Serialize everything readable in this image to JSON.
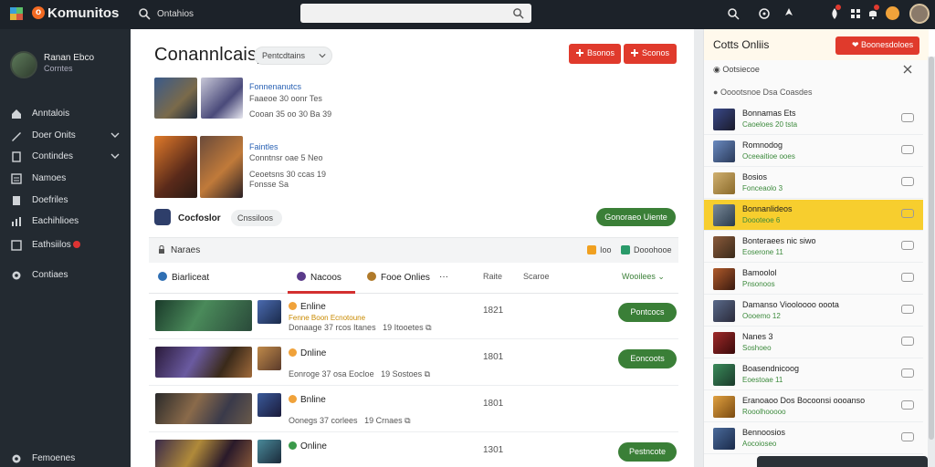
{
  "topbar": {
    "brand": "Komunitos",
    "nav_label": "Ontahios",
    "search_placeholder": "",
    "icons": [
      "search-icon",
      "compass-icon",
      "rocket-icon",
      "fire-icon",
      "grid-icon",
      "bell-icon"
    ]
  },
  "sidebar": {
    "user_name": "Ranan Ebco",
    "user_sub": "Corntes",
    "items": [
      {
        "label": "Anntalois",
        "icon": "home-icon",
        "chevron": false
      },
      {
        "label": "Doer Onits",
        "icon": "tag-icon",
        "chevron": true
      },
      {
        "label": "Contindes",
        "icon": "book-icon",
        "chevron": true
      },
      {
        "label": "Namoes",
        "icon": "list-icon",
        "chevron": false
      },
      {
        "label": "Doefriles",
        "icon": "doc-icon",
        "chevron": false
      },
      {
        "label": "Eachihlioes",
        "icon": "chart-icon",
        "chevron": false
      },
      {
        "label": "Eathsiilos",
        "icon": "flag-icon",
        "chevron": false
      },
      {
        "label": "Contiaes",
        "icon": "settings-icon",
        "chevron": false
      },
      {
        "label": "Femoenes",
        "icon": "gear-icon",
        "chevron": false
      }
    ]
  },
  "main": {
    "title": "Conannlcaisy",
    "dropdown": "Pentcdtains",
    "btn1": "Bsonos",
    "btn2": "Sconos",
    "featured": [
      {
        "title": "Fonnenanutcs",
        "sub1": "Faaeoe 30 oonr Tes",
        "sub2": "Cooan 35 oo 30 Ba 39"
      },
      {
        "title": "Faintles",
        "sub1": "Conntnsr oae 5 Neo",
        "sub2": "Ceoetsns 30 ccas 19",
        "sub3": "Fonsse Sa"
      }
    ],
    "cl_title": "Cocfoslor",
    "cl_pill": "Cnssiloos",
    "cl_btn": "Gonoraeo Uiente",
    "section": {
      "label": "Naraes",
      "tag1": "Ioo",
      "tag2": "Dooohooe"
    },
    "tabs": {
      "t1": "Biarliceat",
      "t2": "Nacoos",
      "t3": "Fooe Onlies",
      "more": "···",
      "c1": "Raite",
      "c2": "Scaroe",
      "sort": "Wooilees"
    },
    "rows": [
      {
        "status": "Enline",
        "tag": "Fenne Boon Ecnotoune",
        "meta": "Donaage 37 rcos Itanes",
        "count": "19 Itooetes",
        "num": "1821",
        "btn": "Pontcocs"
      },
      {
        "status": "Dnline",
        "tag": "",
        "meta": "Eonroge 37 osa Eocloe",
        "count": "19 Sostoes",
        "num": "1801",
        "btn": "Eoncoots"
      },
      {
        "status": "Bnline",
        "tag": "",
        "meta": "Oonegs 37 corlees",
        "count": "19 Crnaes",
        "num": "1801",
        "btn": ""
      },
      {
        "status": "Online",
        "tag": "",
        "meta": "",
        "count": "",
        "num": "1301",
        "btn": "Pestncote"
      }
    ]
  },
  "panel": {
    "title": "Cotts Onliis",
    "btn": "Boonesdoloes",
    "sub": "Ootsiecoe",
    "info": "Ooootsnoe Dsa Coasdes",
    "items": [
      {
        "name": "Bonnamas Ets",
        "status": "Caoeloes 20 tsta",
        "highlight": false
      },
      {
        "name": "Romnodog",
        "status": "Oceeaitioe ooes",
        "highlight": false
      },
      {
        "name": "Bosios",
        "status": "Fonceaolo 3",
        "highlight": false
      },
      {
        "name": "Bonnanlideos",
        "status": "Doooteoe 6",
        "highlight": true
      },
      {
        "name": "Bonteraees nic siwo",
        "status": "Eoserone 11",
        "highlight": false
      },
      {
        "name": "Bamoolol",
        "status": "Pnsonoos",
        "highlight": false
      },
      {
        "name": "Damanso Viooloooo ooota",
        "status": "Oooemo 12",
        "highlight": false
      },
      {
        "name": "Nanes 3",
        "status": "Soshoeo",
        "highlight": false
      },
      {
        "name": "Boasendnicoog",
        "status": "Eoestoae 11",
        "highlight": false
      },
      {
        "name": "Eranoaoo Dos Bocoonsi oooanso",
        "status": "Rooolhooooo",
        "highlight": false
      },
      {
        "name": "Bennoosios",
        "status": "Aocoioseo",
        "highlight": false
      }
    ]
  },
  "colors": {
    "topbar": "#1c2229",
    "sidebar": "#232a31",
    "accent_red": "#e03a2c",
    "accent_green": "#3a7f37",
    "highlight": "#f7ce2e"
  }
}
